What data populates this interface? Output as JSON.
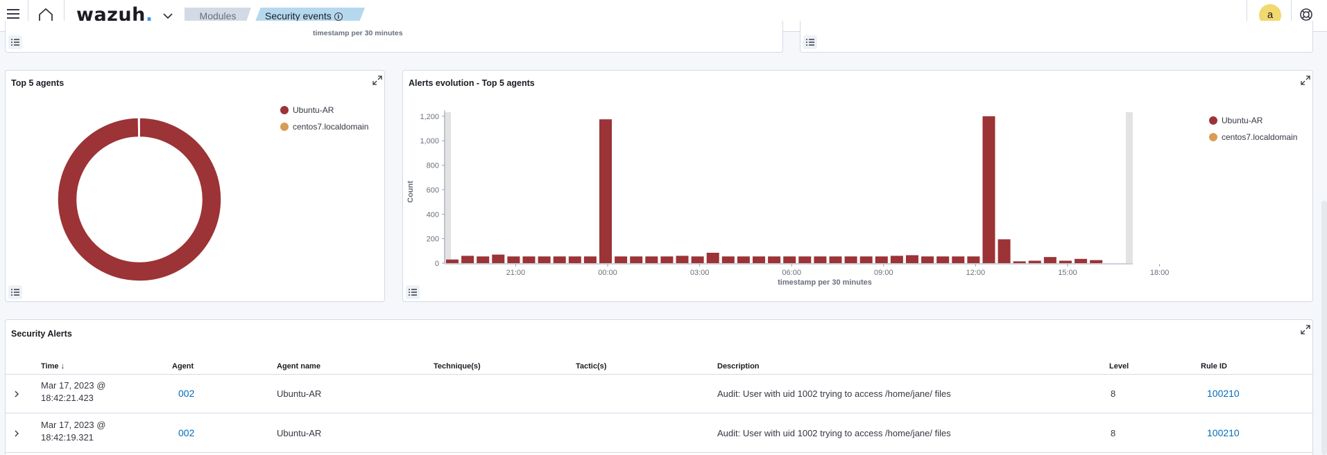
{
  "header": {
    "logo_text": "wazuh",
    "logo_dot": ".",
    "breadcrumbs": [
      "Modules",
      "Security events"
    ],
    "info_icon": "i",
    "avatar_initial": "a"
  },
  "top_strip": {
    "caption": "timestamp per 30 minutes"
  },
  "top5_agents": {
    "title": "Top 5 agents",
    "chart_data": {
      "type": "pie",
      "donut": true,
      "slices": [
        {
          "label": "Ubuntu-AR",
          "value": 99.8,
          "color": "#9c3336"
        },
        {
          "label": "centos7.localdomain",
          "value": 0.2,
          "color": "#d99c56"
        }
      ],
      "legend_position": "top-right"
    }
  },
  "alerts_evolution": {
    "title": "Alerts evolution - Top 5 agents",
    "ylabel": "Count",
    "xlabel": "timestamp per 30 minutes",
    "legend": [
      {
        "label": "Ubuntu-AR",
        "color": "#9c3336"
      },
      {
        "label": "centos7.localdomain",
        "color": "#d99c56"
      }
    ],
    "chart_data": {
      "type": "bar",
      "ylim": [
        0,
        1250
      ],
      "yticks": [
        "0",
        "200",
        "400",
        "600",
        "800",
        "1,000",
        "1,200"
      ],
      "xtick_labels": [
        "21:00",
        "00:00",
        "03:00",
        "06:00",
        "09:00",
        "12:00",
        "15:00",
        "18:00"
      ],
      "series": [
        {
          "name": "Ubuntu-AR",
          "color": "#9c3336",
          "values": [
            30,
            60,
            55,
            70,
            55,
            55,
            55,
            55,
            55,
            55,
            1175,
            55,
            55,
            55,
            55,
            60,
            55,
            85,
            55,
            55,
            55,
            55,
            55,
            55,
            55,
            55,
            55,
            55,
            55,
            60,
            65,
            55,
            55,
            55,
            55,
            1200,
            195,
            15,
            20,
            50,
            20,
            35,
            25,
            0,
            0,
            0,
            0,
            0,
            0
          ]
        }
      ],
      "legend_position": "right"
    }
  },
  "security_alerts": {
    "title": "Security Alerts",
    "columns": [
      "Time",
      "Agent",
      "Agent name",
      "Technique(s)",
      "Tactic(s)",
      "Description",
      "Level",
      "Rule ID"
    ],
    "rows": [
      {
        "time_line1": "Mar 17, 2023 @",
        "time_line2": "18:42:21.423",
        "agent": "002",
        "agent_name": "Ubuntu-AR",
        "technique": "",
        "tactic": "",
        "description": "Audit: User with uid 1002 trying to access /home/jane/ files",
        "level": "8",
        "rule_id": "100210"
      },
      {
        "time_line1": "Mar 17, 2023 @",
        "time_line2": "18:42:19.321",
        "agent": "002",
        "agent_name": "Ubuntu-AR",
        "technique": "",
        "tactic": "",
        "description": "Audit: User with uid 1002 trying to access /home/jane/ files",
        "level": "8",
        "rule_id": "100210"
      }
    ]
  }
}
